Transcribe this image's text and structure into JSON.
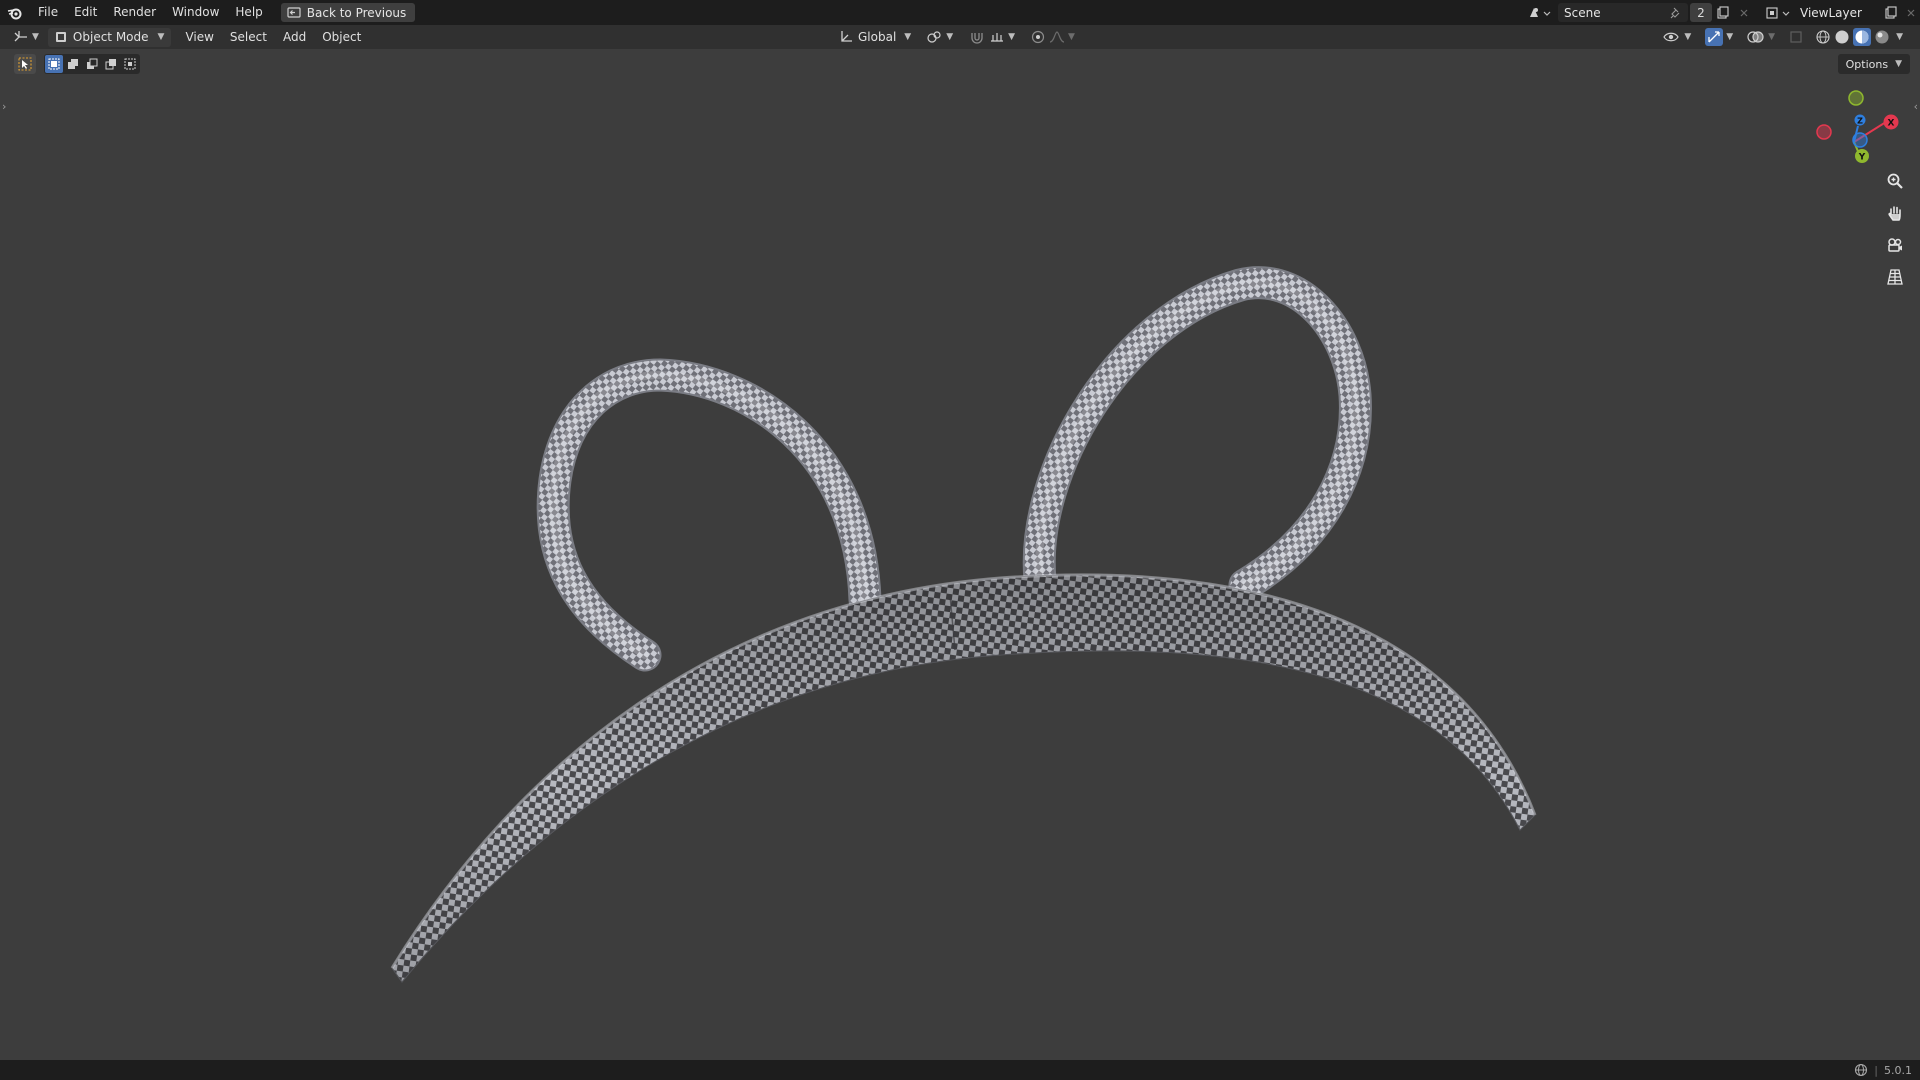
{
  "topbar": {
    "menus": [
      "File",
      "Edit",
      "Render",
      "Window",
      "Help"
    ],
    "back_button": "Back to Previous",
    "scene_name": "Scene",
    "users_count": "2",
    "view_layer": "ViewLayer"
  },
  "header": {
    "mode": "Object Mode",
    "menus": [
      "View",
      "Select",
      "Add",
      "Object"
    ],
    "transform_orientation": "Global"
  },
  "toolbar": {
    "options_label": "Options"
  },
  "gizmo": {
    "axes": [
      "X",
      "Y",
      "Z"
    ],
    "colors": {
      "x": "#e5384f",
      "y": "#8fb82e",
      "z": "#2e7fe0"
    }
  },
  "viewport": {
    "object": "headband-with-ears",
    "material": "checker-texture"
  },
  "statusbar": {
    "version": "5.0.1"
  },
  "colors": {
    "viewport_bg": "#3d3d3d",
    "topbar_bg": "#1d1d1d",
    "header_bg": "#303030",
    "accent": "#4772b3"
  }
}
